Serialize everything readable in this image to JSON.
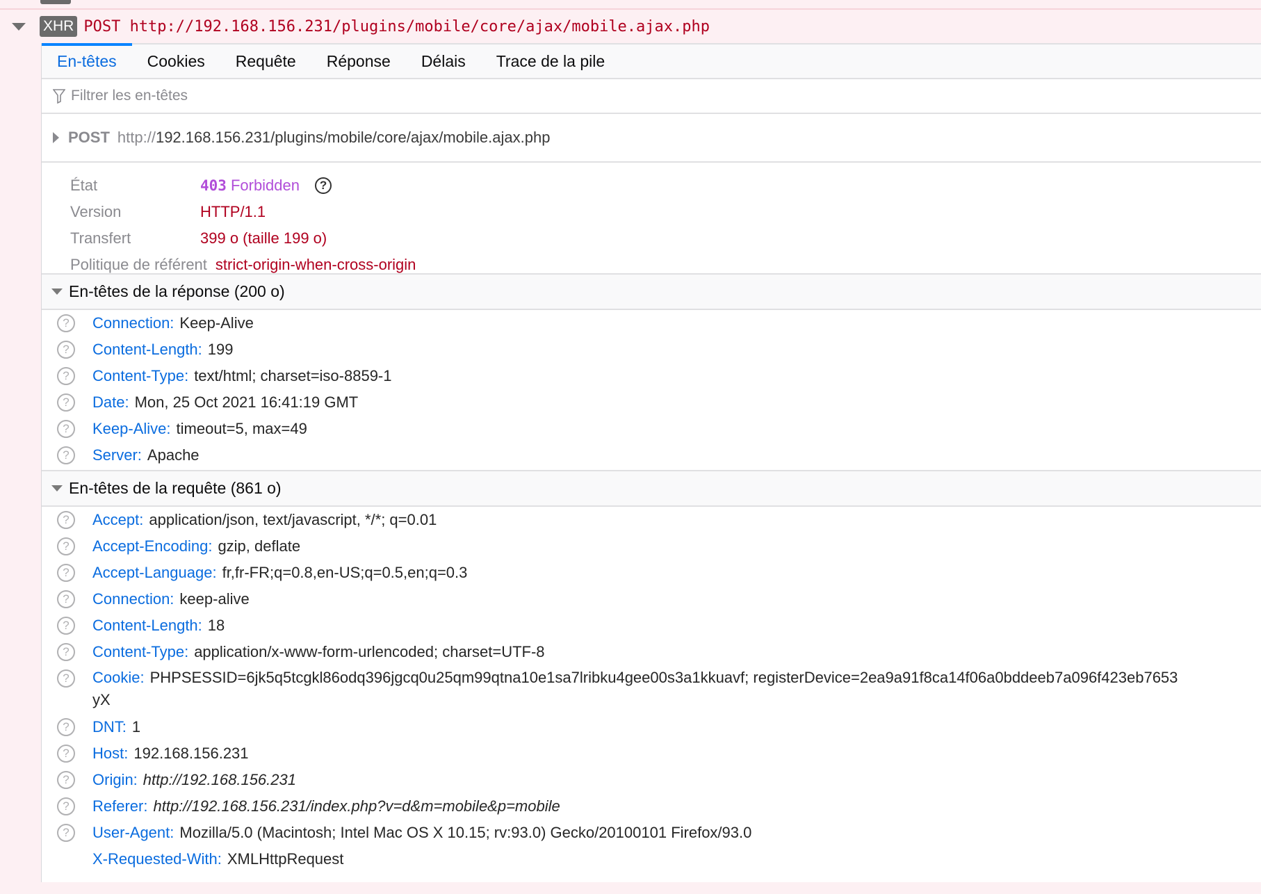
{
  "request_row": {
    "badge": "XHR",
    "line": "POST http://192.168.156.231/plugins/mobile/core/ajax/mobile.ajax.php"
  },
  "tabs": [
    {
      "label": "En-têtes",
      "active": true
    },
    {
      "label": "Cookies"
    },
    {
      "label": "Requête"
    },
    {
      "label": "Réponse"
    },
    {
      "label": "Délais"
    },
    {
      "label": "Trace de la pile"
    }
  ],
  "filter": {
    "placeholder": "Filtrer les en-têtes",
    "value": ""
  },
  "summary": {
    "method": "POST",
    "scheme": "http://",
    "url_rest": "192.168.156.231/plugins/mobile/core/ajax/mobile.ajax.php"
  },
  "status": {
    "state_label": "État",
    "code": "403",
    "text": "Forbidden",
    "version_label": "Version",
    "version": "HTTP/1.1",
    "transfer_label": "Transfert",
    "transfer": "399 o (taille 199 o)",
    "referrer_label": "Politique de référent",
    "referrer": "strict-origin-when-cross-origin"
  },
  "response_headers": {
    "title": "En-têtes de la réponse (200 o)",
    "items": [
      {
        "name": "Connection:",
        "value": "Keep-Alive"
      },
      {
        "name": "Content-Length:",
        "value": "199"
      },
      {
        "name": "Content-Type:",
        "value": "text/html; charset=iso-8859-1"
      },
      {
        "name": "Date:",
        "value": "Mon, 25 Oct 2021 16:41:19 GMT"
      },
      {
        "name": "Keep-Alive:",
        "value": "timeout=5, max=49"
      },
      {
        "name": "Server:",
        "value": "Apache"
      }
    ]
  },
  "request_headers": {
    "title": "En-têtes de la requête (861 o)",
    "items": [
      {
        "name": "Accept:",
        "value": "application/json, text/javascript, */*; q=0.01"
      },
      {
        "name": "Accept-Encoding:",
        "value": "gzip, deflate"
      },
      {
        "name": "Accept-Language:",
        "value": "fr,fr-FR;q=0.8,en-US;q=0.5,en;q=0.3"
      },
      {
        "name": "Connection:",
        "value": "keep-alive"
      },
      {
        "name": "Content-Length:",
        "value": "18"
      },
      {
        "name": "Content-Type:",
        "value": "application/x-www-form-urlencoded; charset=UTF-8"
      },
      {
        "name": "Cookie:",
        "value": "PHPSESSID=6jk5q5tcgkl86odq396jgcq0u25qm99qtna10e1sa7lribku4gee00s3a1kkuavf; registerDevice=2ea9a91f8ca14f06a0bddeeb7a096f423eb7653",
        "value_wrap": "yX"
      },
      {
        "name": "DNT:",
        "value": "1"
      },
      {
        "name": "Host:",
        "value": "192.168.156.231"
      },
      {
        "name": "Origin:",
        "value": "http://192.168.156.231"
      },
      {
        "name": "Referer:",
        "value": "http://192.168.156.231/index.php?v=d&m=mobile&p=mobile"
      },
      {
        "name": "User-Agent:",
        "value": "Mozilla/5.0 (Macintosh; Intel Mac OS X 10.15; rv:93.0) Gecko/20100101 Firefox/93.0"
      },
      {
        "name": "X-Requested-With:",
        "value": "XMLHttpRequest"
      }
    ]
  }
}
